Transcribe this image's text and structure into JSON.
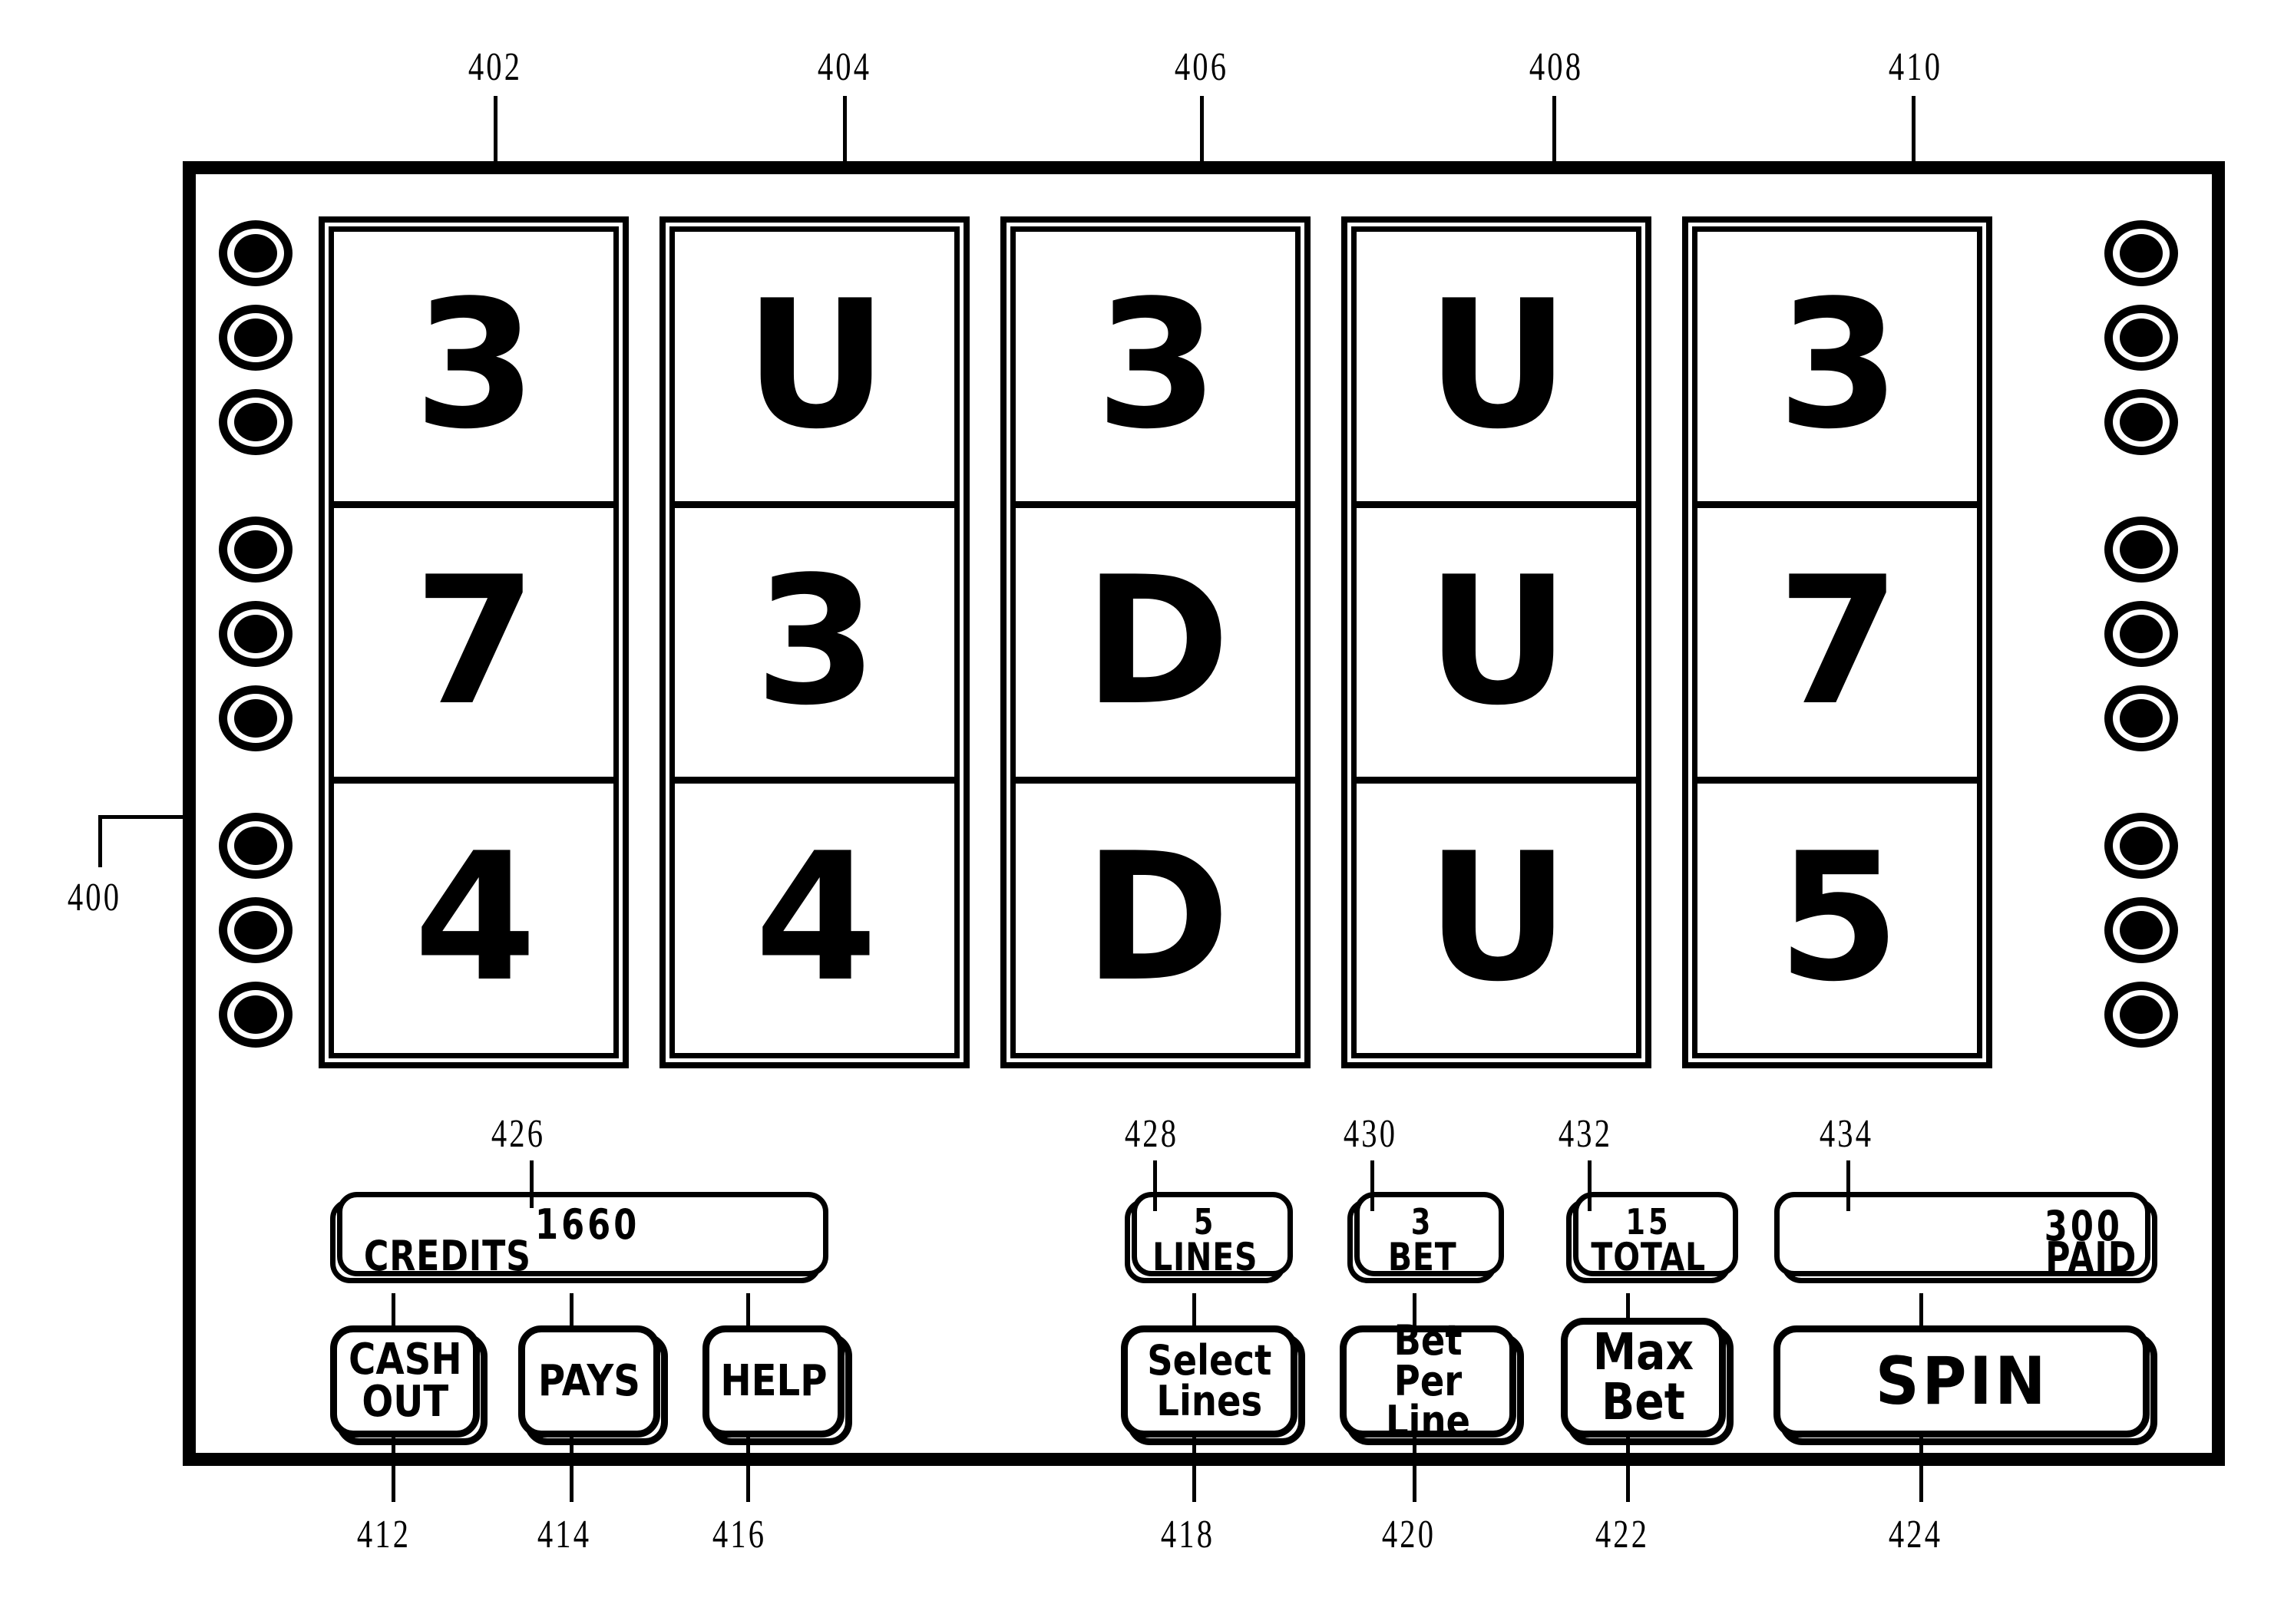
{
  "figure": {
    "machine_ref": "400",
    "reel_refs": [
      "402",
      "404",
      "406",
      "408",
      "410"
    ],
    "meter_refs": {
      "credits": "426",
      "lines": "428",
      "bet": "430",
      "total": "432",
      "paid": "434"
    },
    "button_refs": {
      "cash_out": "412",
      "pays": "414",
      "help": "416",
      "select_lines": "418",
      "bet_per_line": "420",
      "max_bet": "422",
      "spin": "424"
    }
  },
  "reels": [
    {
      "ref": "402",
      "symbols": [
        "3",
        "7",
        "4"
      ]
    },
    {
      "ref": "404",
      "symbols": [
        "U",
        "3",
        "4"
      ]
    },
    {
      "ref": "406",
      "symbols": [
        "3",
        "D",
        "D"
      ]
    },
    {
      "ref": "408",
      "symbols": [
        "U",
        "U",
        "U"
      ]
    },
    {
      "ref": "410",
      "symbols": [
        "3",
        "7",
        "5"
      ]
    }
  ],
  "lamps": {
    "left_count": 9,
    "right_count": 9,
    "groups": 3,
    "per_group": 3
  },
  "meters": {
    "credits": {
      "label": "CREDITS",
      "value": "1660"
    },
    "lines": {
      "label": "LINES",
      "value": "5"
    },
    "bet": {
      "label": "BET",
      "value": "3"
    },
    "total": {
      "label": "TOTAL",
      "value": "15"
    },
    "paid": {
      "label": "PAID",
      "value": "300"
    }
  },
  "buttons": {
    "cash_out": {
      "line1": "CASH",
      "line2": "OUT"
    },
    "pays": {
      "line1": "PAYS"
    },
    "help": {
      "line1": "HELP"
    },
    "select_lines": {
      "line1": "Select",
      "line2": "Lines"
    },
    "bet_per_line": {
      "line1": "Bet Per",
      "line2": "Line"
    },
    "max_bet": {
      "line1": "Max",
      "line2": "Bet"
    },
    "spin": {
      "line1": "SPIN"
    }
  },
  "colors": {
    "ink": "#000000",
    "paper": "#ffffff"
  }
}
